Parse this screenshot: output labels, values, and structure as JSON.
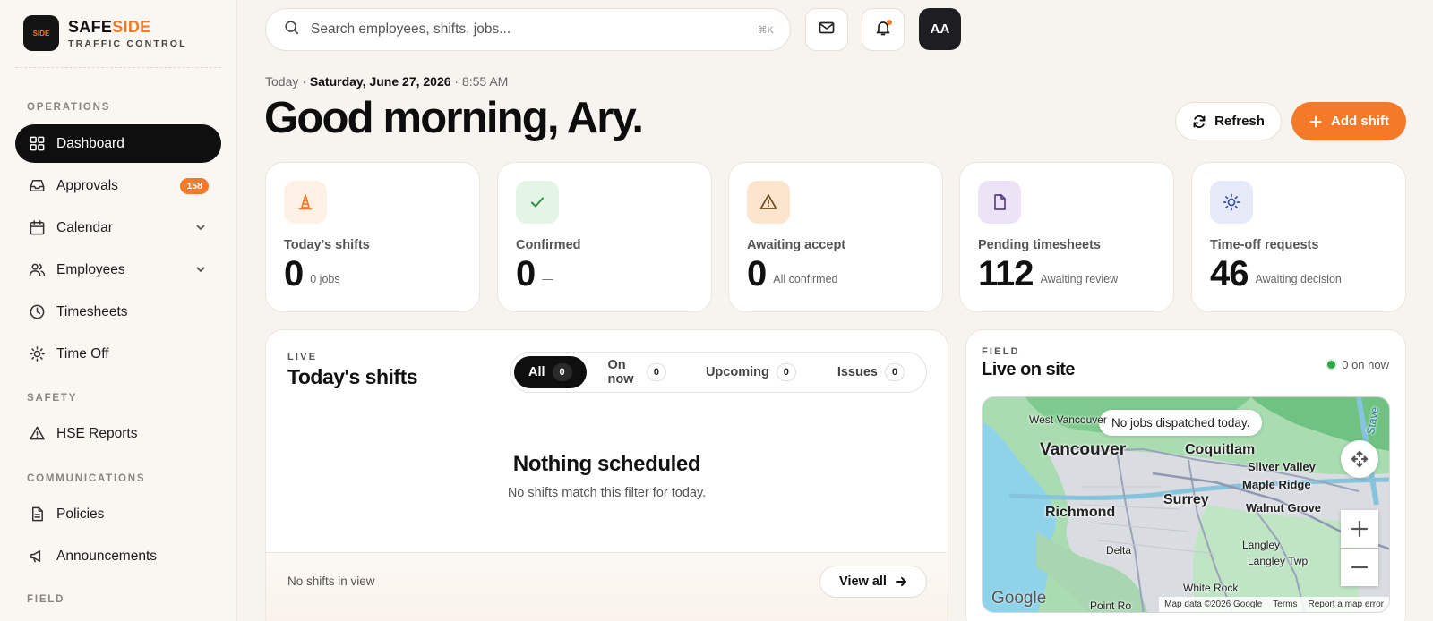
{
  "brand": {
    "logo_text": "SIDE",
    "name_part1": "SAFE",
    "name_part2": "SIDE",
    "subtitle": "TRAFFIC CONTROL"
  },
  "sidebar": {
    "sections": [
      "OPERATIONS",
      "SAFETY",
      "COMMUNICATIONS",
      "FIELD"
    ],
    "items": [
      {
        "label": "Dashboard",
        "icon": "grid-icon",
        "active": true
      },
      {
        "label": "Approvals",
        "icon": "inbox-icon",
        "badge": "158"
      },
      {
        "label": "Calendar",
        "icon": "calendar-icon",
        "expandable": true
      },
      {
        "label": "Employees",
        "icon": "users-icon",
        "expandable": true
      },
      {
        "label": "Timesheets",
        "icon": "clock-icon"
      },
      {
        "label": "Time Off",
        "icon": "sun-icon"
      },
      {
        "label": "HSE Reports",
        "icon": "warning-icon"
      },
      {
        "label": "Policies",
        "icon": "document-icon"
      },
      {
        "label": "Announcements",
        "icon": "megaphone-icon"
      }
    ]
  },
  "topbar": {
    "search_placeholder": "Search employees, shifts, jobs...",
    "search_shortcut": "⌘K",
    "avatar_initials": "AA"
  },
  "header": {
    "date_prefix": "Today ·",
    "date": "Saturday, June 27, 2026",
    "time": "· 8:55 AM",
    "greeting": "Good morning, Ary.",
    "refresh_label": "Refresh",
    "add_label": "Add shift"
  },
  "stats": [
    {
      "label": "Today's shifts",
      "value": "0",
      "sub": "0 jobs",
      "icon": "traffic-cone-icon",
      "color": "#fdf1e6"
    },
    {
      "label": "Confirmed",
      "value": "0",
      "sub": "—",
      "icon": "check-icon",
      "color": "#e4f4e6"
    },
    {
      "label": "Awaiting accept",
      "value": "0",
      "sub": "All confirmed",
      "icon": "warning-icon",
      "color": "#fbe5cc"
    },
    {
      "label": "Pending timesheets",
      "value": "112",
      "sub": "Awaiting review",
      "icon": "document-icon",
      "color": "#ece4f6"
    },
    {
      "label": "Time-off requests",
      "value": "46",
      "sub": "Awaiting decision",
      "icon": "sun-icon",
      "color": "#e6e9f8"
    }
  ],
  "shifts": {
    "eyebrow": "LIVE",
    "title": "Today's shifts",
    "tabs": [
      {
        "label": "All",
        "count": "0",
        "active": true
      },
      {
        "label": "On now",
        "count": "0"
      },
      {
        "label": "Upcoming",
        "count": "0"
      },
      {
        "label": "Issues",
        "count": "0"
      }
    ],
    "empty_title": "Nothing scheduled",
    "empty_sub": "No shifts match this filter for today.",
    "footer_text": "No shifts in view",
    "view_all": "View all"
  },
  "field": {
    "eyebrow": "FIELD",
    "title": "Live on site",
    "on_now": "0 on now",
    "map_pill": "No jobs dispatched today.",
    "places": [
      "West Vancouver",
      "Vancouver",
      "Coquitlam",
      "Silver Valley",
      "Maple Ridge",
      "Surrey",
      "Walnut Grove",
      "Richmond",
      "Delta",
      "Langley",
      "Langley Twp",
      "White Rock",
      "Point Ro",
      "Stave"
    ],
    "routes": [
      "1",
      "1",
      "7",
      "17",
      "15",
      "13"
    ],
    "google": "Google",
    "attribution": [
      "Map data ©2026 Google",
      "Terms",
      "Report a map error"
    ]
  }
}
